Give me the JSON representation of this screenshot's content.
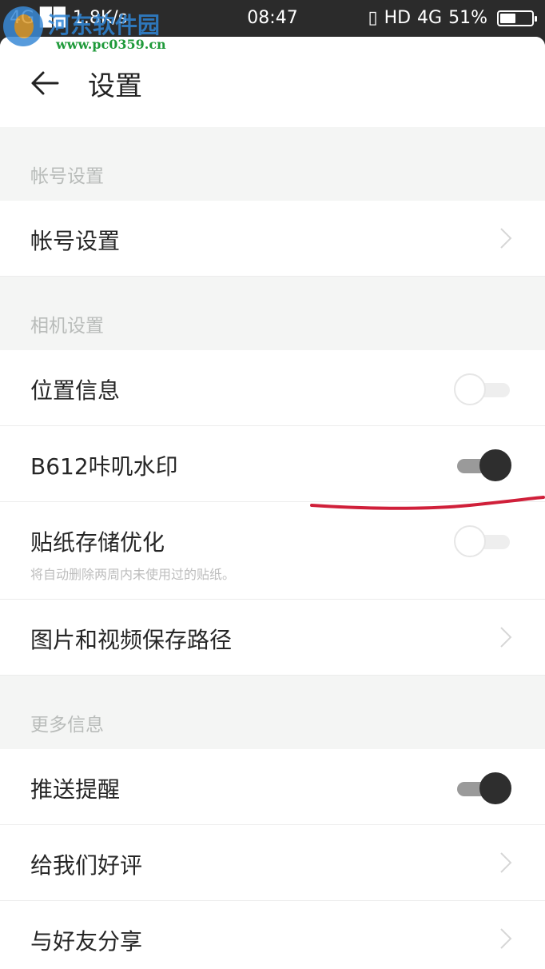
{
  "status_bar": {
    "network_left": "4G",
    "speed": "1.8K/s",
    "time": "08:47",
    "hd": "HD",
    "network_right": "4G",
    "battery": "51%",
    "battery_level": 0.51
  },
  "watermark": {
    "site_name": "河东软件园",
    "url": "www.pc0359.cn"
  },
  "header": {
    "title": "设置",
    "back_icon": "arrow-left-icon"
  },
  "sections": [
    {
      "label": "帐号设置",
      "rows": [
        {
          "label": "帐号设置",
          "control": "chevron"
        }
      ]
    },
    {
      "label": "相机设置",
      "rows": [
        {
          "label": "位置信息",
          "control": "toggle",
          "on": false
        },
        {
          "label": "B612咔叽水印",
          "control": "toggle",
          "on": true
        },
        {
          "label": "贴纸存储优化",
          "subtitle": "将自动删除两周内未使用过的贴纸。",
          "control": "toggle",
          "on": false
        },
        {
          "label": "图片和视频保存路径",
          "control": "chevron"
        }
      ]
    },
    {
      "label": "更多信息",
      "rows": [
        {
          "label": "推送提醒",
          "control": "toggle",
          "on": true
        },
        {
          "label": "给我们好评",
          "control": "chevron"
        },
        {
          "label": "与好友分享",
          "control": "chevron"
        }
      ]
    }
  ],
  "colors": {
    "status_bar_bg": "#2b2b2b",
    "section_bg": "#f4f5f4",
    "toggle_on_knob": "#2e2e2e",
    "annotation_red": "#d0203a"
  }
}
